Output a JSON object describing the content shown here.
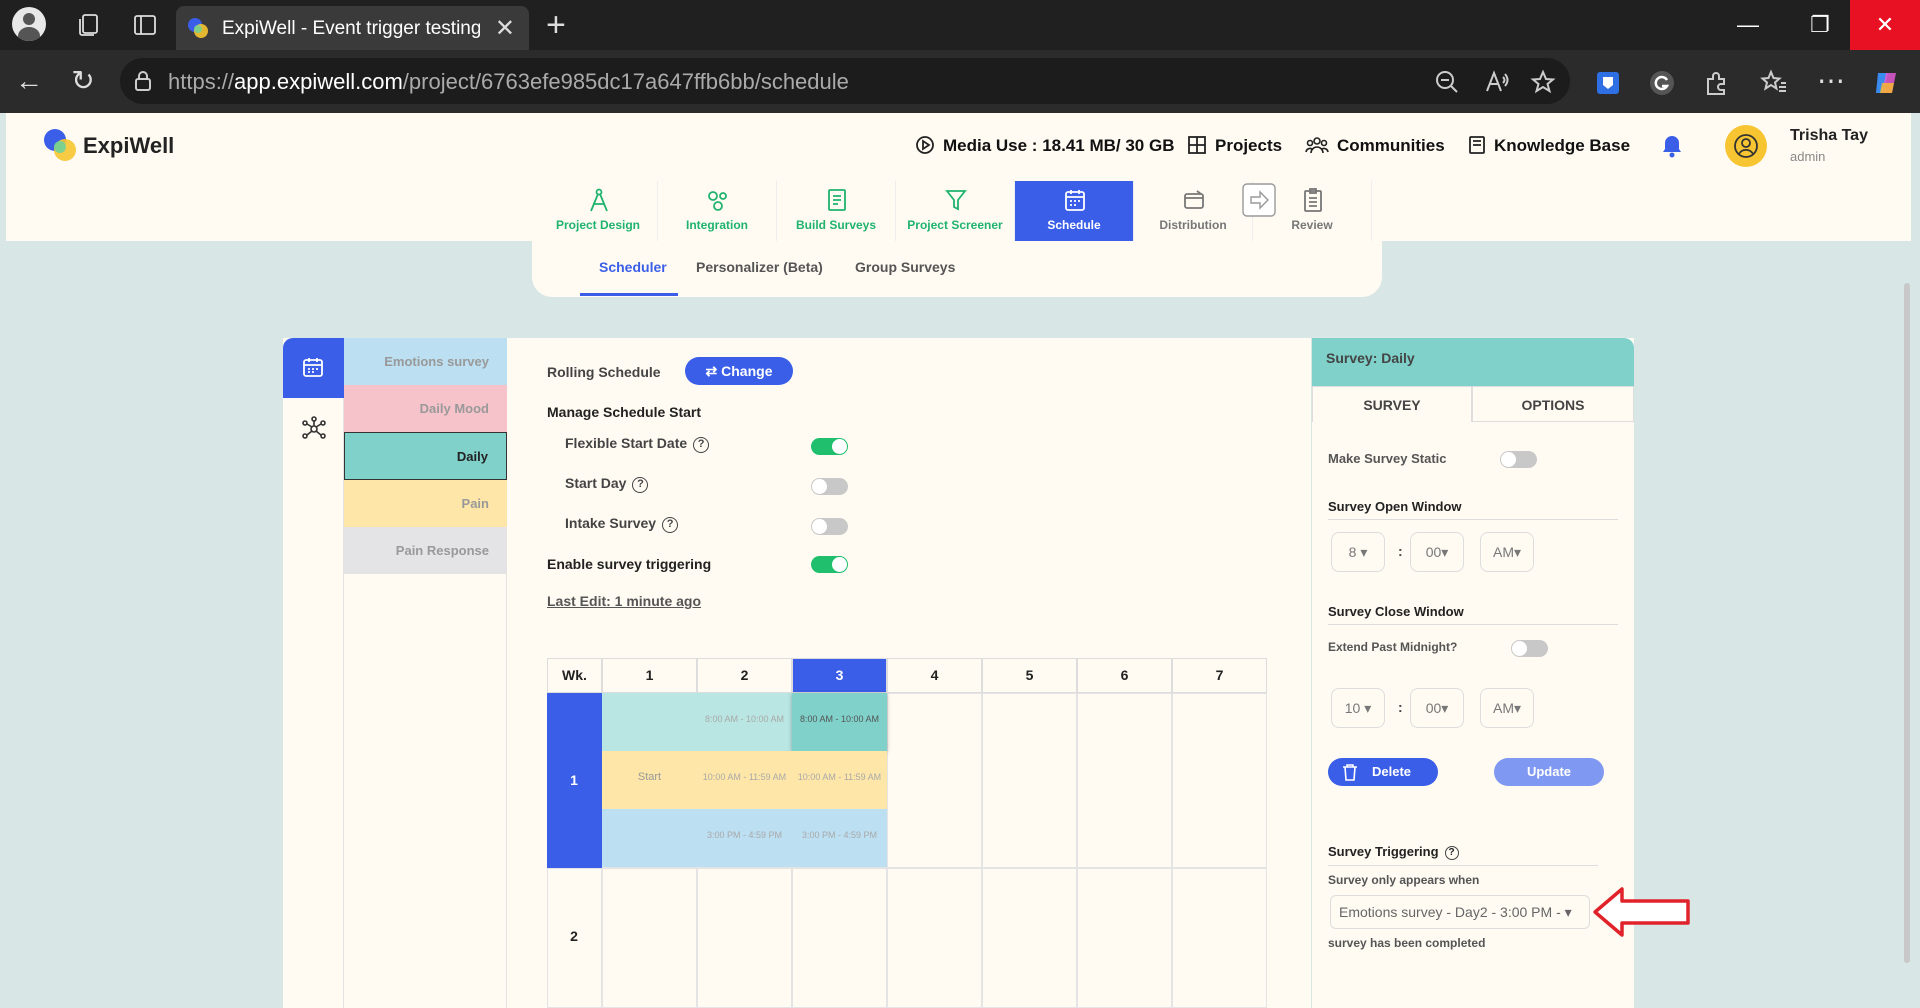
{
  "browser": {
    "tab_title": "ExpiWell - Event trigger testing (C",
    "url_prefix": "https://",
    "url_domain": "app.expiwell.com",
    "url_path": "/project/6763efe985dc17a647ffb6bb/schedule"
  },
  "header": {
    "brand": "ExpiWell",
    "media_use": "Media Use : 18.41 MB/ 30 GB",
    "projects": "Projects",
    "communities": "Communities",
    "knowledge_base": "Knowledge Base",
    "user_name": "Trisha Tay",
    "user_role": "admin"
  },
  "steps": [
    {
      "label": "Project Design"
    },
    {
      "label": "Integration"
    },
    {
      "label": "Build Surveys"
    },
    {
      "label": "Project Screener"
    },
    {
      "label": "Schedule"
    },
    {
      "label": "Distribution"
    },
    {
      "label": "Review"
    }
  ],
  "subtabs": [
    "Scheduler",
    "Personalizer (Beta)",
    "Group Surveys"
  ],
  "surveys": [
    {
      "name": "Emotions survey",
      "color": "#bcdff2"
    },
    {
      "name": "Daily Mood",
      "color": "#f7c3cb"
    },
    {
      "name": "Daily",
      "color": "#7fd1ca"
    },
    {
      "name": "Pain",
      "color": "#fde6a8"
    },
    {
      "name": "Pain Response",
      "color": "#e4e4e6"
    }
  ],
  "schedule": {
    "rolling_label": "Rolling Schedule",
    "change_label": "Change",
    "manage_start": "Manage Schedule Start",
    "flexible_start": "Flexible Start Date",
    "start_day": "Start Day",
    "intake_survey": "Intake Survey",
    "enable_trigger": "Enable survey triggering",
    "last_edit": "Last Edit: 1 minute ago",
    "question_mark": "?",
    "toggles": {
      "flexible_start": true,
      "start_day": false,
      "intake_survey": false,
      "enable_trigger": true
    }
  },
  "grid": {
    "wk_label": "Wk.",
    "days": [
      "1",
      "2",
      "3",
      "4",
      "5",
      "6",
      "7"
    ],
    "active_day": "3",
    "weeks": [
      "1",
      "2"
    ],
    "start_label": "Start",
    "blocks": {
      "row1_d2": "8:00 AM - 10:00 AM",
      "row1_d3": "8:00 AM - 10:00 AM",
      "row2_d2": "10:00 AM - 11:59 AM",
      "row2_d3": "10:00 AM - 11:59 AM",
      "row3_d2": "3:00 PM - 4:59 PM",
      "row3_d3": "3:00 PM - 4:59 PM"
    }
  },
  "panel": {
    "title": "Survey: Daily",
    "tab_survey": "SURVEY",
    "tab_options": "OPTIONS",
    "make_static": "Make Survey Static",
    "open_window": "Survey Open Window",
    "open_hour": "8",
    "open_min": "00",
    "open_ampm": "AM",
    "close_window": "Survey Close Window",
    "extend_midnight": "Extend Past Midnight?",
    "close_hour": "10",
    "close_min": "00",
    "close_ampm": "AM",
    "colon": ":",
    "delete_label": "Delete",
    "update_label": "Update",
    "triggering_title": "Survey Triggering",
    "appears_when": "Survey only appears when",
    "trigger_value": "Emotions survey - Day2 - 3:00 PM -",
    "completed": "survey has been completed"
  },
  "colors": {
    "accent": "#3a5ee8",
    "green": "#1fb36e",
    "teal": "#7fd1ca",
    "arrow": "#e0232a"
  }
}
